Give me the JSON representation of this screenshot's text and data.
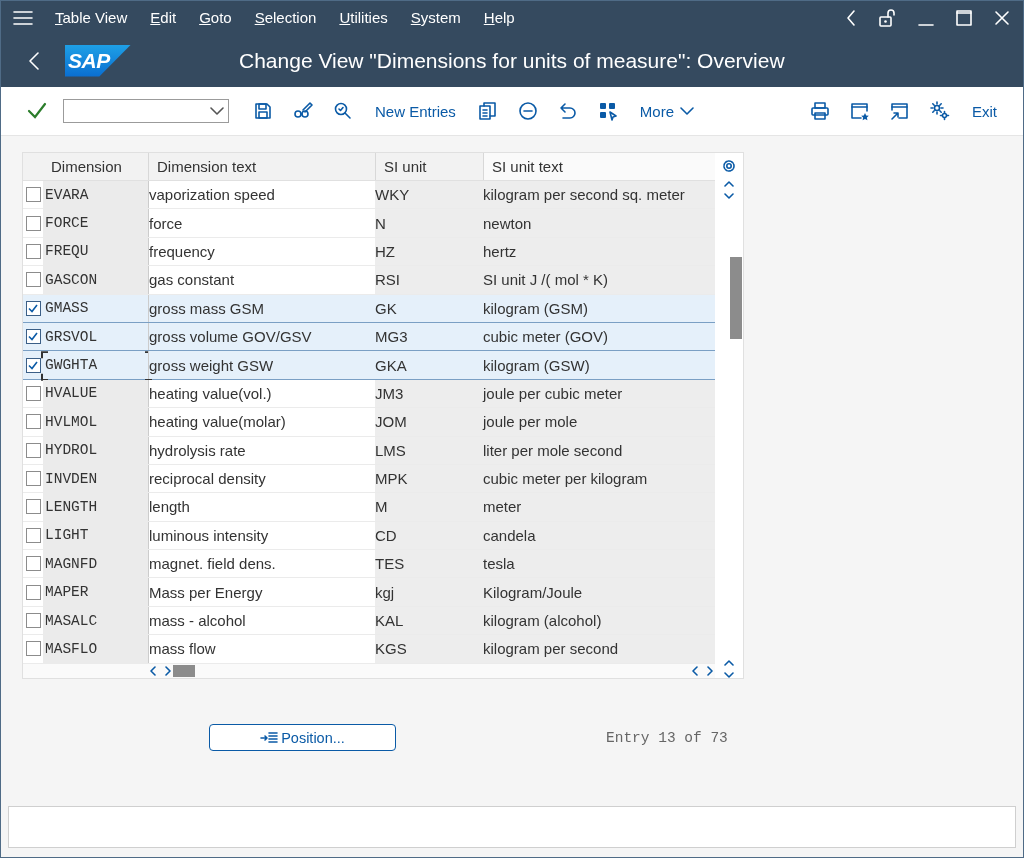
{
  "menu": [
    {
      "label": "Table View"
    },
    {
      "label": "Edit"
    },
    {
      "label": "Goto"
    },
    {
      "label": "Selection"
    },
    {
      "label": "Utilities"
    },
    {
      "label": "System"
    },
    {
      "label": "Help"
    }
  ],
  "title": "Change View \"Dimensions for units of measure\": Overview",
  "logo": "SAP",
  "toolbar": {
    "new_entries": "New Entries",
    "more": "More",
    "exit": "Exit"
  },
  "table": {
    "columns": [
      "Dimension",
      "Dimension text",
      "SI unit",
      "SI unit text"
    ],
    "rows": [
      {
        "dimension": "EVARA",
        "dimension_text": "vaporization speed",
        "si_unit": "WKY",
        "si_unit_text": "kilogram per second sq. meter",
        "checked": false,
        "focused": false
      },
      {
        "dimension": "FORCE",
        "dimension_text": "force",
        "si_unit": "N",
        "si_unit_text": "newton",
        "checked": false,
        "focused": false
      },
      {
        "dimension": "FREQU",
        "dimension_text": "frequency",
        "si_unit": "HZ",
        "si_unit_text": "hertz",
        "checked": false,
        "focused": false
      },
      {
        "dimension": "GASCON",
        "dimension_text": "gas constant",
        "si_unit": "RSI",
        "si_unit_text": "SI unit J /( mol * K)",
        "checked": false,
        "focused": false
      },
      {
        "dimension": "GMASS",
        "dimension_text": "gross mass GSM",
        "si_unit": "GK",
        "si_unit_text": "kilogram (GSM)",
        "checked": true,
        "focused": false
      },
      {
        "dimension": "GRSVOL",
        "dimension_text": "gross volume GOV/GSV",
        "si_unit": "MG3",
        "si_unit_text": "cubic meter (GOV)",
        "checked": true,
        "focused": false
      },
      {
        "dimension": "GWGHTA",
        "dimension_text": "gross weight GSW",
        "si_unit": "GKA",
        "si_unit_text": "kilogram (GSW)",
        "checked": true,
        "focused": true
      },
      {
        "dimension": "HVALUE",
        "dimension_text": "heating value(vol.)",
        "si_unit": "JM3",
        "si_unit_text": "joule per cubic meter",
        "checked": false,
        "focused": false
      },
      {
        "dimension": "HVLMOL",
        "dimension_text": "heating value(molar)",
        "si_unit": "JOM",
        "si_unit_text": "joule per mole",
        "checked": false,
        "focused": false
      },
      {
        "dimension": "HYDROL",
        "dimension_text": "hydrolysis rate",
        "si_unit": "LMS",
        "si_unit_text": "liter per mole second",
        "checked": false,
        "focused": false
      },
      {
        "dimension": "INVDEN",
        "dimension_text": "reciprocal density",
        "si_unit": "MPK",
        "si_unit_text": "cubic meter per kilogram",
        "checked": false,
        "focused": false
      },
      {
        "dimension": "LENGTH",
        "dimension_text": "length",
        "si_unit": "M",
        "si_unit_text": "meter",
        "checked": false,
        "focused": false
      },
      {
        "dimension": "LIGHT",
        "dimension_text": "luminous intensity",
        "si_unit": "CD",
        "si_unit_text": "candela",
        "checked": false,
        "focused": false
      },
      {
        "dimension": "MAGNFD",
        "dimension_text": "magnet. field dens.",
        "si_unit": "TES",
        "si_unit_text": "tesla",
        "checked": false,
        "focused": false
      },
      {
        "dimension": "MAPER",
        "dimension_text": "Mass per Energy",
        "si_unit": "kgj",
        "si_unit_text": "Kilogram/Joule",
        "checked": false,
        "focused": false
      },
      {
        "dimension": "MASALC",
        "dimension_text": "mass - alcohol",
        "si_unit": "KAL",
        "si_unit_text": "kilogram (alcohol)",
        "checked": false,
        "focused": false
      },
      {
        "dimension": "MASFLO",
        "dimension_text": "mass flow",
        "si_unit": "KGS",
        "si_unit_text": "kilogram per second",
        "checked": false,
        "focused": false
      }
    ]
  },
  "position_button": "Position...",
  "entry_info": "Entry 13 of 73"
}
